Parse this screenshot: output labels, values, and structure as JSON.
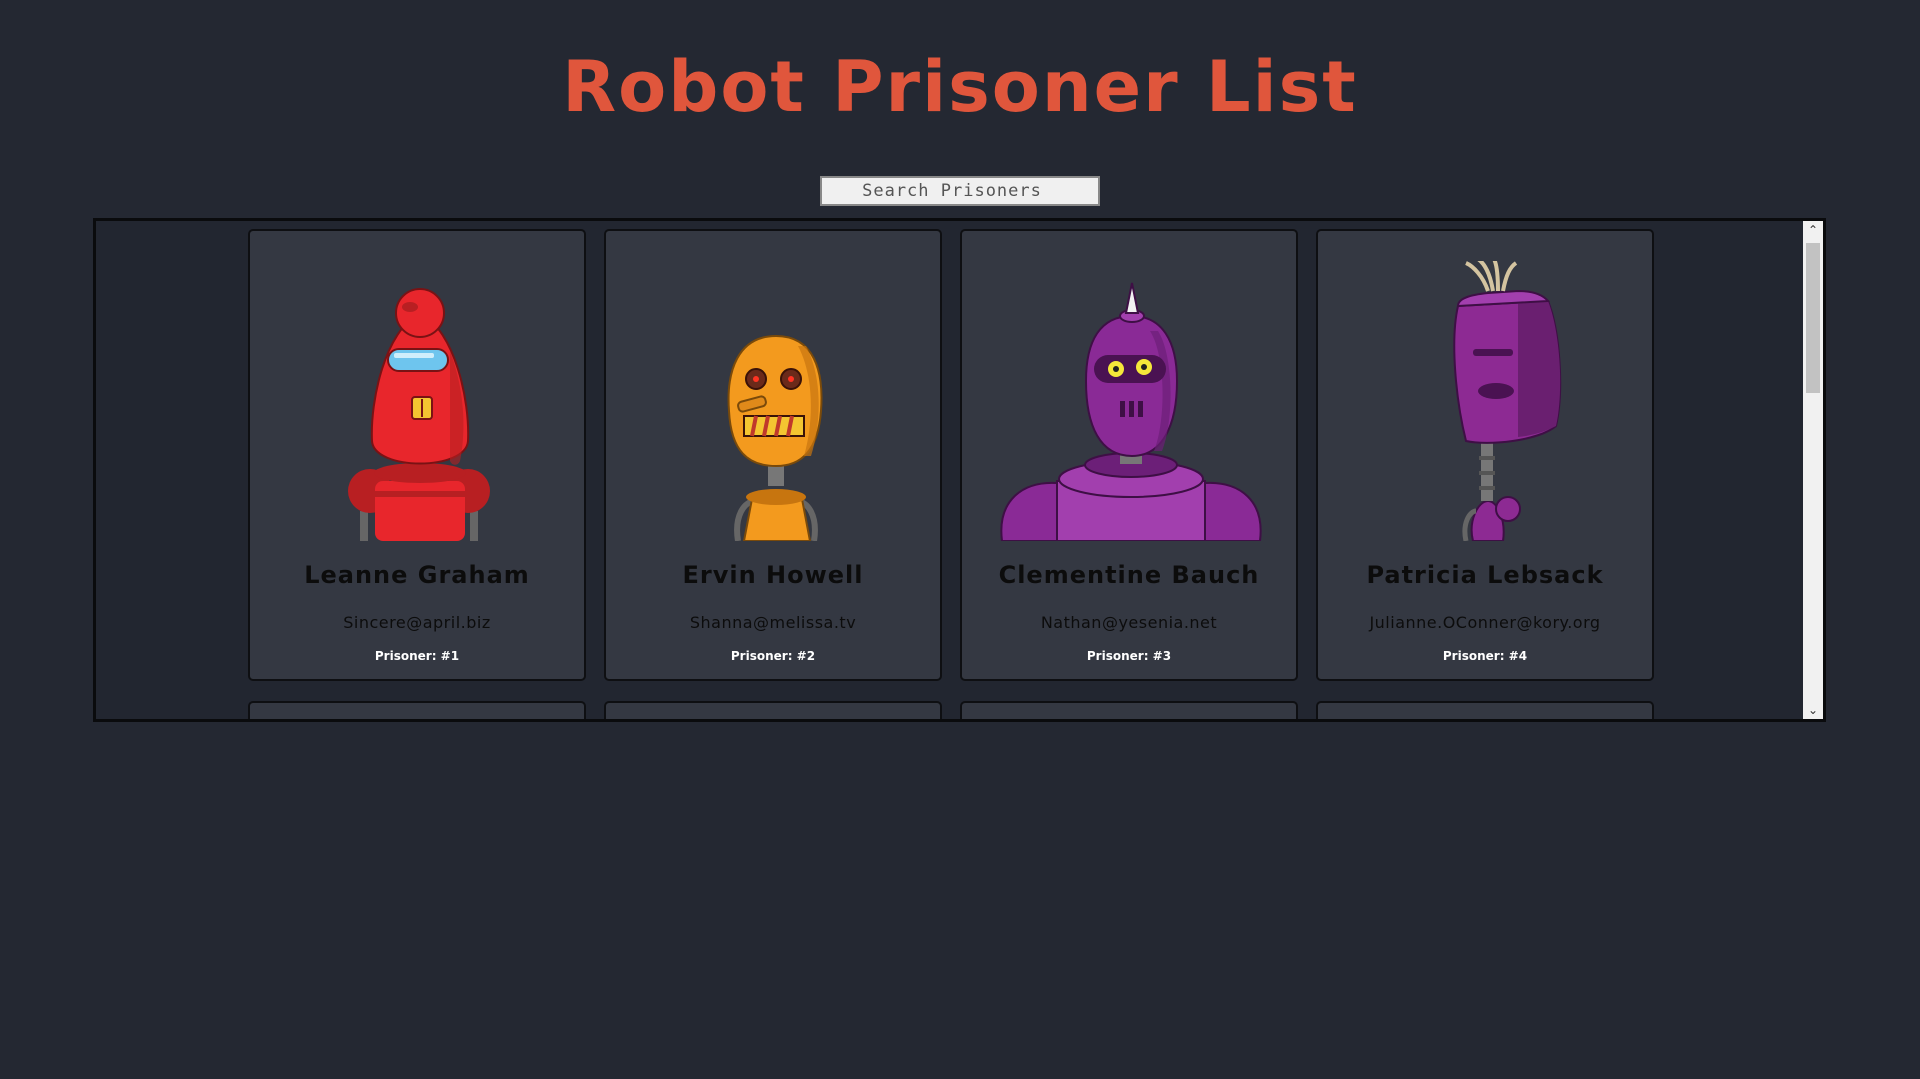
{
  "header": {
    "title": "Robot Prisoner List"
  },
  "search": {
    "placeholder": "Search Prisoners"
  },
  "prisoners": [
    {
      "name": "Leanne Graham",
      "email": "Sincere@april.biz",
      "id_label": "Prisoner: #1",
      "color": "#e8262c",
      "avatar": "red-robot"
    },
    {
      "name": "Ervin Howell",
      "email": "Shanna@melissa.tv",
      "id_label": "Prisoner: #2",
      "color": "#f39a1e",
      "avatar": "orange-robot"
    },
    {
      "name": "Clementine Bauch",
      "email": "Nathan@yesenia.net",
      "id_label": "Prisoner: #3",
      "color": "#8a2a96",
      "avatar": "purple-robot"
    },
    {
      "name": "Patricia Lebsack",
      "email": "Julianne.OConner@kory.org",
      "id_label": "Prisoner: #4",
      "color": "#8d2a93",
      "avatar": "purple-robot"
    }
  ],
  "scrollbar": {
    "up_icon": "chevron-up-icon",
    "down_icon": "chevron-down-icon"
  }
}
